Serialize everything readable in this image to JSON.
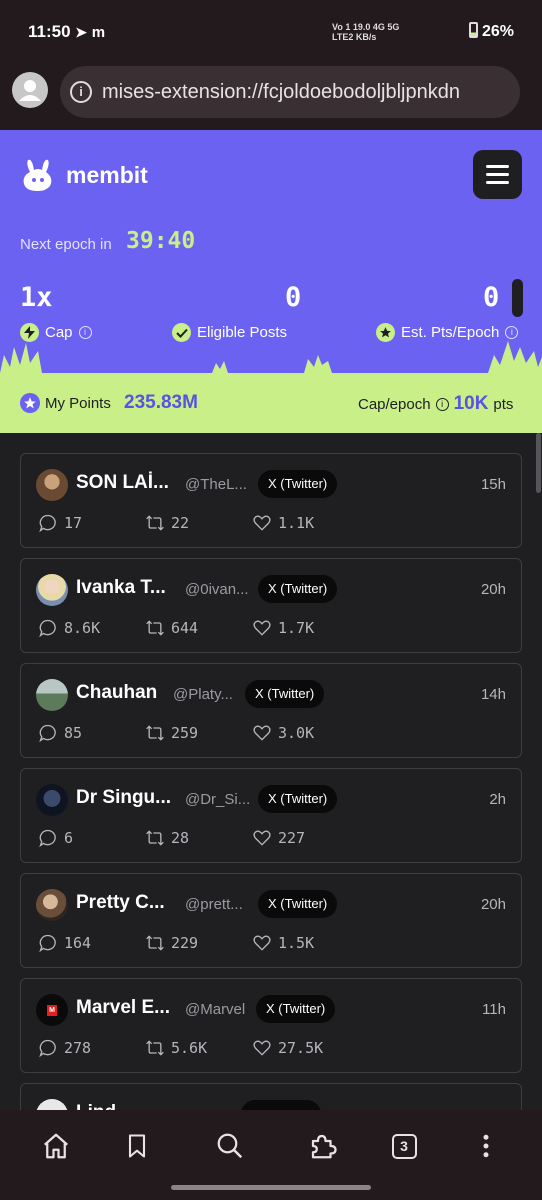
{
  "status_bar": {
    "time": "11:50",
    "network_line1": "Vo 1 19.0 4G  5G",
    "network_line2": "LTE2 KB/s",
    "battery": "26%"
  },
  "browser": {
    "url": "mises-extension://fcjoldoebodoljbljpnkdn"
  },
  "app": {
    "name": "membit",
    "accent_color": "#6b62f2",
    "highlight_color": "#c8ef88",
    "next_epoch_label": "Next epoch in",
    "next_epoch_time": "39:40",
    "stats": {
      "cap_value": "1x",
      "cap_label": "Cap",
      "eligible_value": "0",
      "eligible_label": "Eligible Posts",
      "est_value": "0",
      "est_label": "Est. Pts/Epoch"
    },
    "points": {
      "label": "My Points",
      "value": "235.83M",
      "cap_label": "Cap/epoch",
      "cap_value": "10K",
      "cap_unit": "pts"
    }
  },
  "posts": [
    {
      "name": "SON LAİ...",
      "handle": "@TheL...",
      "source": "X (Twitter)",
      "age": "15h",
      "replies": "17",
      "reposts": "22",
      "likes": "1.1K"
    },
    {
      "name": "Ivanka T...",
      "handle": "@0ivan...",
      "source": "X (Twitter)",
      "age": "20h",
      "replies": "8.6K",
      "reposts": "644",
      "likes": "1.7K"
    },
    {
      "name": "Chauhan",
      "handle": "@Platy...",
      "source": "X (Twitter)",
      "age": "14h",
      "replies": "85",
      "reposts": "259",
      "likes": "3.0K"
    },
    {
      "name": "Dr Singu...",
      "handle": "@Dr_Si...",
      "source": "X (Twitter)",
      "age": "2h",
      "replies": "6",
      "reposts": "28",
      "likes": "227"
    },
    {
      "name": "Pretty C...",
      "handle": "@prett...",
      "source": "X (Twitter)",
      "age": "20h",
      "replies": "164",
      "reposts": "229",
      "likes": "1.5K"
    },
    {
      "name": "Marvel E...",
      "handle": "@Marvel",
      "source": "X (Twitter)",
      "age": "11h",
      "replies": "278",
      "reposts": "5.6K",
      "likes": "27.5K"
    },
    {
      "name": "Lind...",
      "handle": "",
      "source": "",
      "age": "",
      "replies": "",
      "reposts": "",
      "likes": ""
    }
  ],
  "navbar": {
    "icons": [
      "home-icon",
      "bookmark-icon",
      "search-icon",
      "extensions-icon",
      "tabs-icon",
      "more-icon"
    ],
    "tab_count": "3"
  }
}
